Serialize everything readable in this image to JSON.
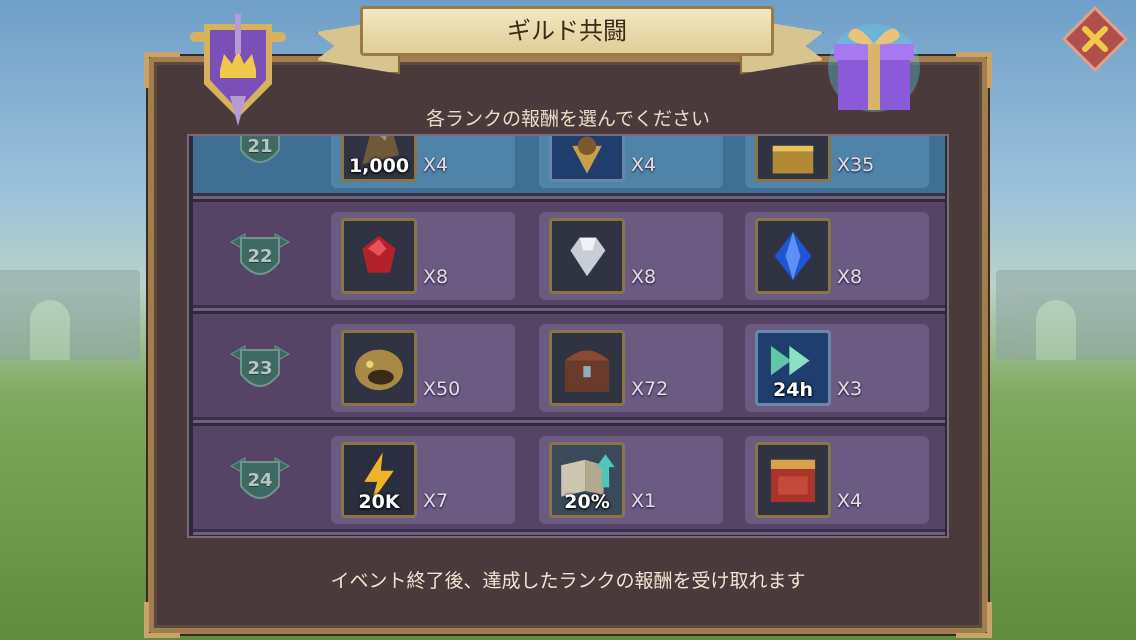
{
  "title": "ギルド共闘",
  "subtitle": "各ランクの報酬を選んでください",
  "footer": "イベント終了後、達成したランクの報酬を受け取れます",
  "colors": {
    "frame": "#a27d4e",
    "panel": "#4a3a3c",
    "row": "#554465",
    "slot": "#6b5a82",
    "accent": "#d8c48e"
  },
  "ranks": [
    {
      "rank": "21",
      "rewards": [
        {
          "icon": "gold-ore-icon",
          "label": "1,000",
          "qty": "X4"
        },
        {
          "icon": "guild-crest-icon",
          "label": "",
          "qty": "X4"
        },
        {
          "icon": "gold-chest-icon",
          "label": "",
          "qty": "X35"
        }
      ]
    },
    {
      "rank": "22",
      "rewards": [
        {
          "icon": "red-gem-icon",
          "label": "",
          "qty": "X8"
        },
        {
          "icon": "white-gem-icon",
          "label": "",
          "qty": "X8"
        },
        {
          "icon": "blue-crystal-icon",
          "label": "",
          "qty": "X8"
        }
      ]
    },
    {
      "rank": "23",
      "rewards": [
        {
          "icon": "monster-head-icon",
          "label": "",
          "qty": "X50"
        },
        {
          "icon": "treasure-chest-icon",
          "label": "",
          "qty": "X72"
        },
        {
          "icon": "speedup-arrow-icon",
          "label": "24h",
          "qty": "X3"
        }
      ]
    },
    {
      "rank": "24",
      "rewards": [
        {
          "icon": "lightning-energy-icon",
          "label": "20K",
          "qty": "X7"
        },
        {
          "icon": "book-boost-icon",
          "label": "20%",
          "qty": "X1"
        },
        {
          "icon": "red-crate-icon",
          "label": "",
          "qty": "X4"
        }
      ]
    }
  ]
}
